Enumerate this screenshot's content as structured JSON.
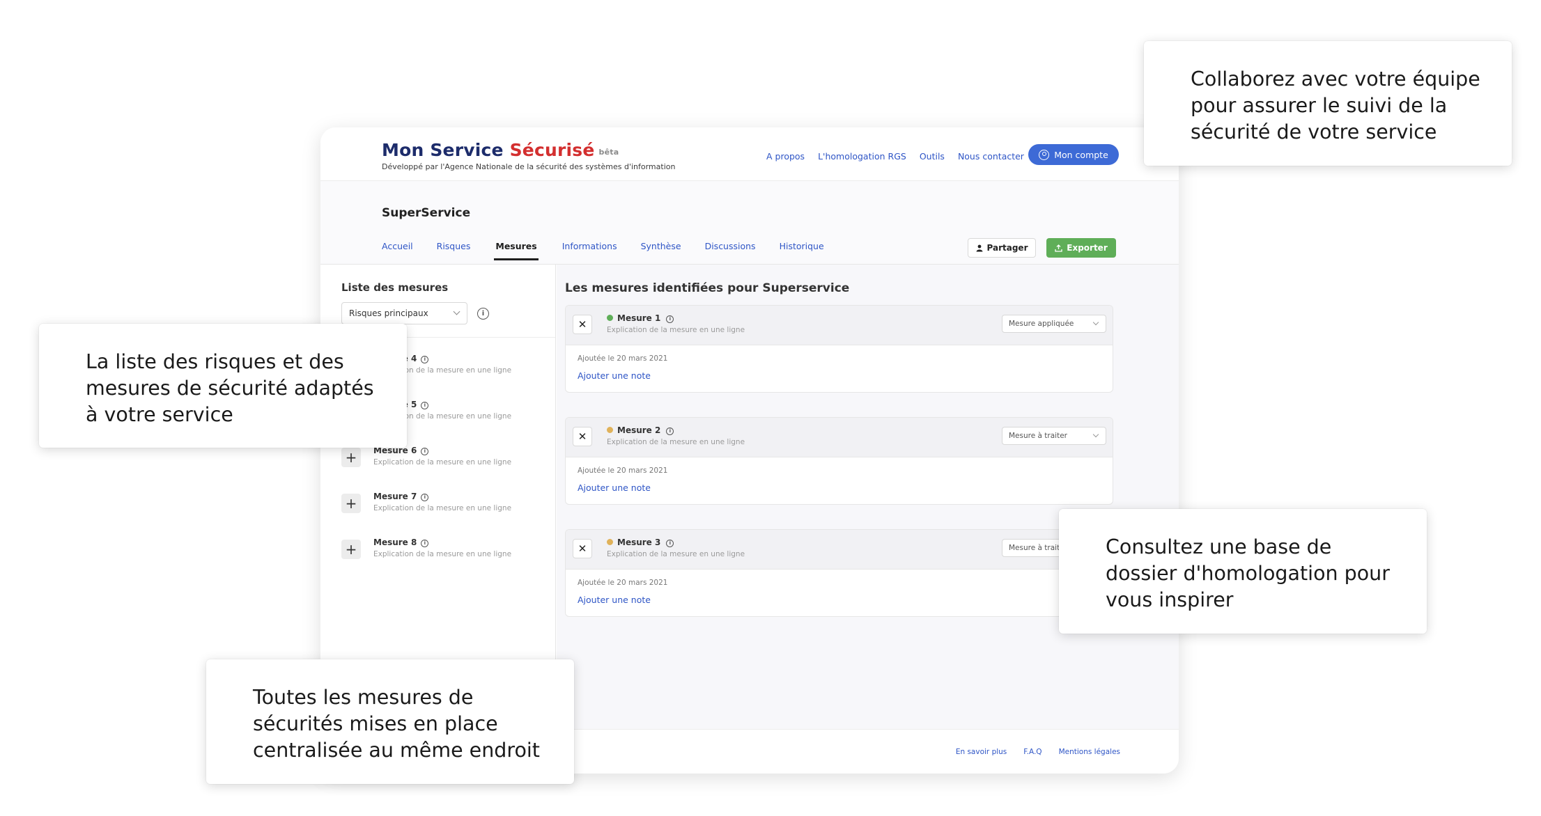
{
  "header": {
    "brand_part1": "Mon Service",
    "brand_part2": "Sécurisé",
    "beta_label": "bêta",
    "subtitle": "Développé par l'Agence Nationale de la sécurité des systèmes d'information",
    "nav": [
      "A propos",
      "L'homologation RGS",
      "Outils",
      "Nous contacter"
    ],
    "account_label": "Mon compte"
  },
  "service": {
    "name": "SuperService",
    "tabs": [
      {
        "label": "Accueil",
        "active": false
      },
      {
        "label": "Risques",
        "active": false
      },
      {
        "label": "Mesures",
        "active": true
      },
      {
        "label": "Informations",
        "active": false
      },
      {
        "label": "Synthèse",
        "active": false
      },
      {
        "label": "Discussions",
        "active": false
      },
      {
        "label": "Historique",
        "active": false
      }
    ],
    "share_label": "Partager",
    "export_label": "Exporter"
  },
  "sidebar": {
    "title": "Liste des mesures",
    "filter_value": "Risques principaux",
    "items": [
      {
        "name": "Mesure 4",
        "desc": "Explication de la mesure en une ligne"
      },
      {
        "name": "Mesure 5",
        "desc": "Explication de la mesure en une ligne"
      },
      {
        "name": "Mesure 6",
        "desc": "Explication de la mesure en une ligne"
      },
      {
        "name": "Mesure 7",
        "desc": "Explication de la mesure en une ligne"
      },
      {
        "name": "Mesure 8",
        "desc": "Explication de la mesure en une ligne"
      }
    ]
  },
  "main": {
    "title": "Les mesures identifiées pour Superservice",
    "cards": [
      {
        "name": "Mesure 1",
        "desc": "Explication de la mesure en une ligne",
        "status": "Mesure appliquée",
        "dot_color": "#5fae58",
        "date": "Ajoutée le 20 mars 2021",
        "note_link": "Ajouter une note"
      },
      {
        "name": "Mesure 2",
        "desc": "Explication de la mesure en une ligne",
        "status": "Mesure à traiter",
        "dot_color": "#e0b25a",
        "date": "Ajoutée le 20 mars 2021",
        "note_link": "Ajouter une note"
      },
      {
        "name": "Mesure 3",
        "desc": "Explication de la mesure en une ligne",
        "status": "Mesure à traiter",
        "dot_color": "#e0b25a",
        "date": "Ajoutée le 20 mars 2021",
        "note_link": "Ajouter une note"
      }
    ]
  },
  "footer": {
    "links": [
      "En savoir plus",
      "F.A.Q",
      "Mentions légales"
    ]
  },
  "callouts": {
    "collaborate": [
      "Collaborez avec votre équipe",
      "pour assurer le suivi de la",
      "sécurité de votre service"
    ],
    "risks": [
      "La liste des risques et des",
      "mesures de sécurité adaptés",
      "à votre service"
    ],
    "dossier": [
      "Consultez une base de",
      "dossier d'homologation pour",
      "vous inspirer"
    ],
    "measures": [
      "Toutes les mesures de",
      "sécurités mises en place",
      "centralisée au même endroit"
    ]
  },
  "colors": {
    "brand_blue": "#1d2c6b",
    "brand_red": "#d32f2f",
    "link_blue": "#2e55c6",
    "button_blue": "#3d6ad6",
    "export_green": "#5fae58"
  }
}
